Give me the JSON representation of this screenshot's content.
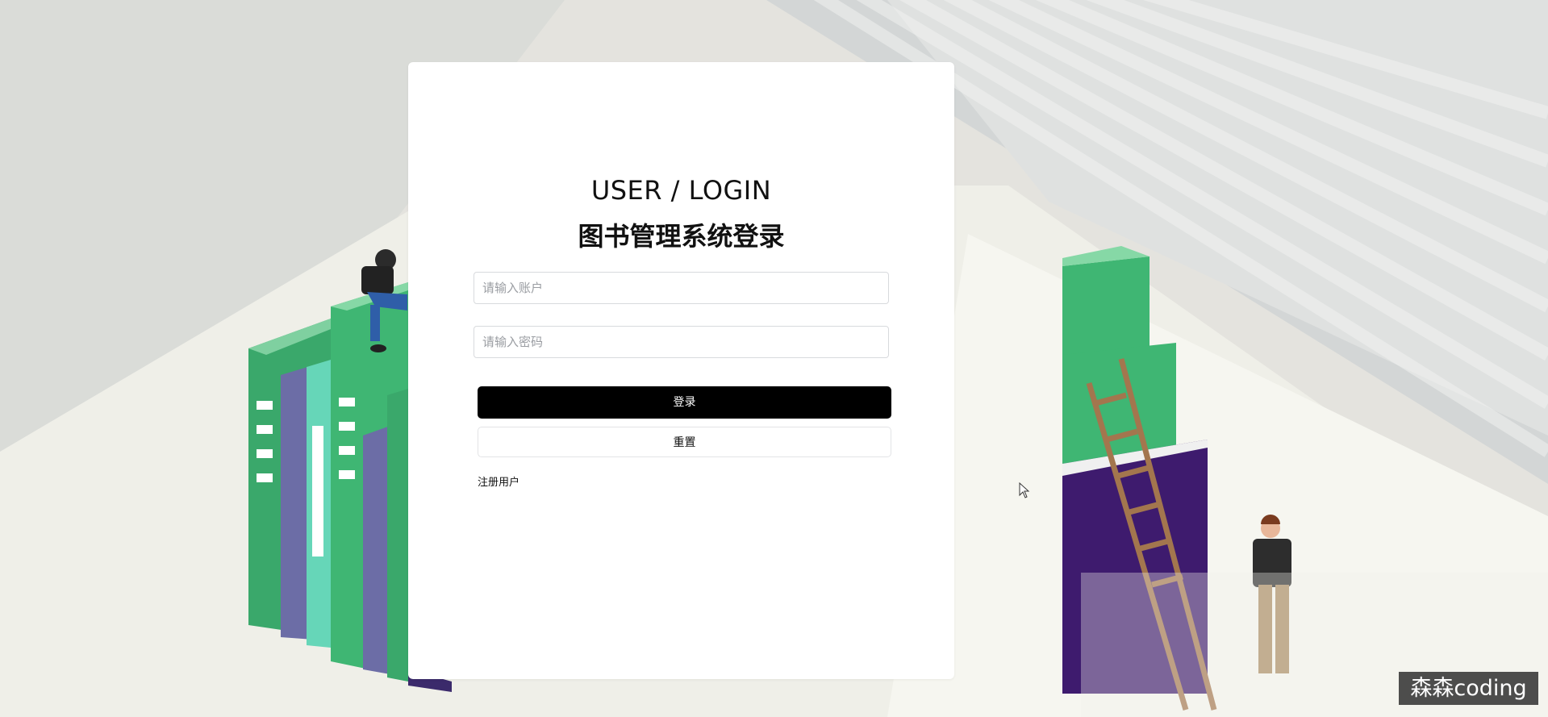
{
  "login": {
    "title_en": "USER / LOGIN",
    "title_cn": "图书管理系统登录",
    "account_placeholder": "请输入账户",
    "password_placeholder": "请输入密码",
    "login_label": "登录",
    "reset_label": "重置",
    "register_label": "注册用户"
  },
  "watermark": {
    "text": "森森coding"
  },
  "icons": [
    "mouse-cursor-icon"
  ],
  "colors": {
    "login_button_bg": "#000000",
    "card_bg": "#ffffff",
    "book_green": "#3fb673",
    "book_purple": "#3e1b6e",
    "page_bg": "#e6e5e0"
  }
}
